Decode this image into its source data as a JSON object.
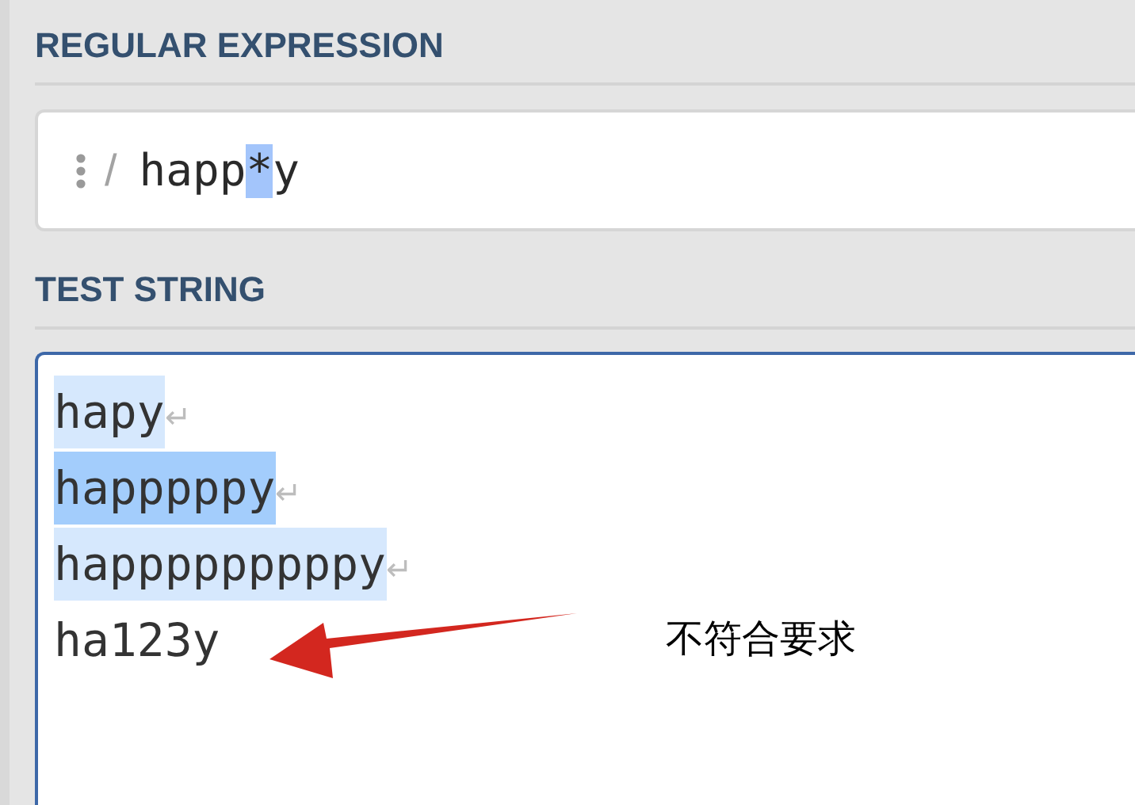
{
  "regex_section": {
    "heading": "REGULAR EXPRESSION",
    "delimiter": "/",
    "segments": [
      {
        "text": "happ",
        "highlighted": false
      },
      {
        "text": "*",
        "highlighted": true
      },
      {
        "text": "y",
        "highlighted": false
      }
    ]
  },
  "test_section": {
    "heading": "TEST STRING",
    "lines": [
      {
        "text": "hapy",
        "highlighted": true,
        "selected": false,
        "end_mark": "↵"
      },
      {
        "text": "happpppy",
        "highlighted": true,
        "selected": true,
        "end_mark": "↵"
      },
      {
        "text": "happpppppppy",
        "highlighted": true,
        "selected": false,
        "end_mark": "↵"
      },
      {
        "text": "ha123y",
        "highlighted": false,
        "selected": false
      }
    ],
    "annotation": {
      "text": "不符合要求"
    }
  }
}
